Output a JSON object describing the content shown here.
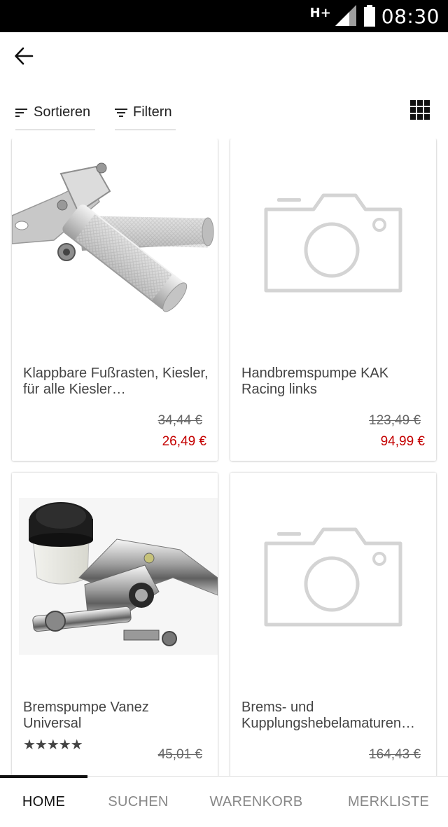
{
  "status_bar": {
    "network": "H+",
    "time": "08:30"
  },
  "toolbar": {
    "sort_label": "Sortieren",
    "filter_label": "Filtern"
  },
  "products": [
    {
      "title": "Klappbare Fußrasten, Kiesler, für alle Kiesler…",
      "old_price": "34,44 €",
      "price": "26,49 €",
      "image": "footpeg-photo"
    },
    {
      "title": "Handbremspumpe KAK Racing links",
      "old_price": "123,49 €",
      "price": "94,99 €",
      "image": "camera-placeholder-icon"
    },
    {
      "title": "Bremspumpe Vanez Universal",
      "rating": "★★★★★",
      "old_price": "45,01 €",
      "image": "brake-pump-photo"
    },
    {
      "title": "Brems- und Kupplungshebelamaturen…",
      "old_price": "164,43 €",
      "image": "camera-placeholder-icon"
    }
  ],
  "bottom_nav": {
    "home": "HOME",
    "search": "SUCHEN",
    "cart": "WARENKORB",
    "wishlist": "MERKLISTE"
  },
  "colors": {
    "sale_price": "#c40000",
    "placeholder_icon": "#d4d4d4",
    "status_bar": "#000000"
  }
}
